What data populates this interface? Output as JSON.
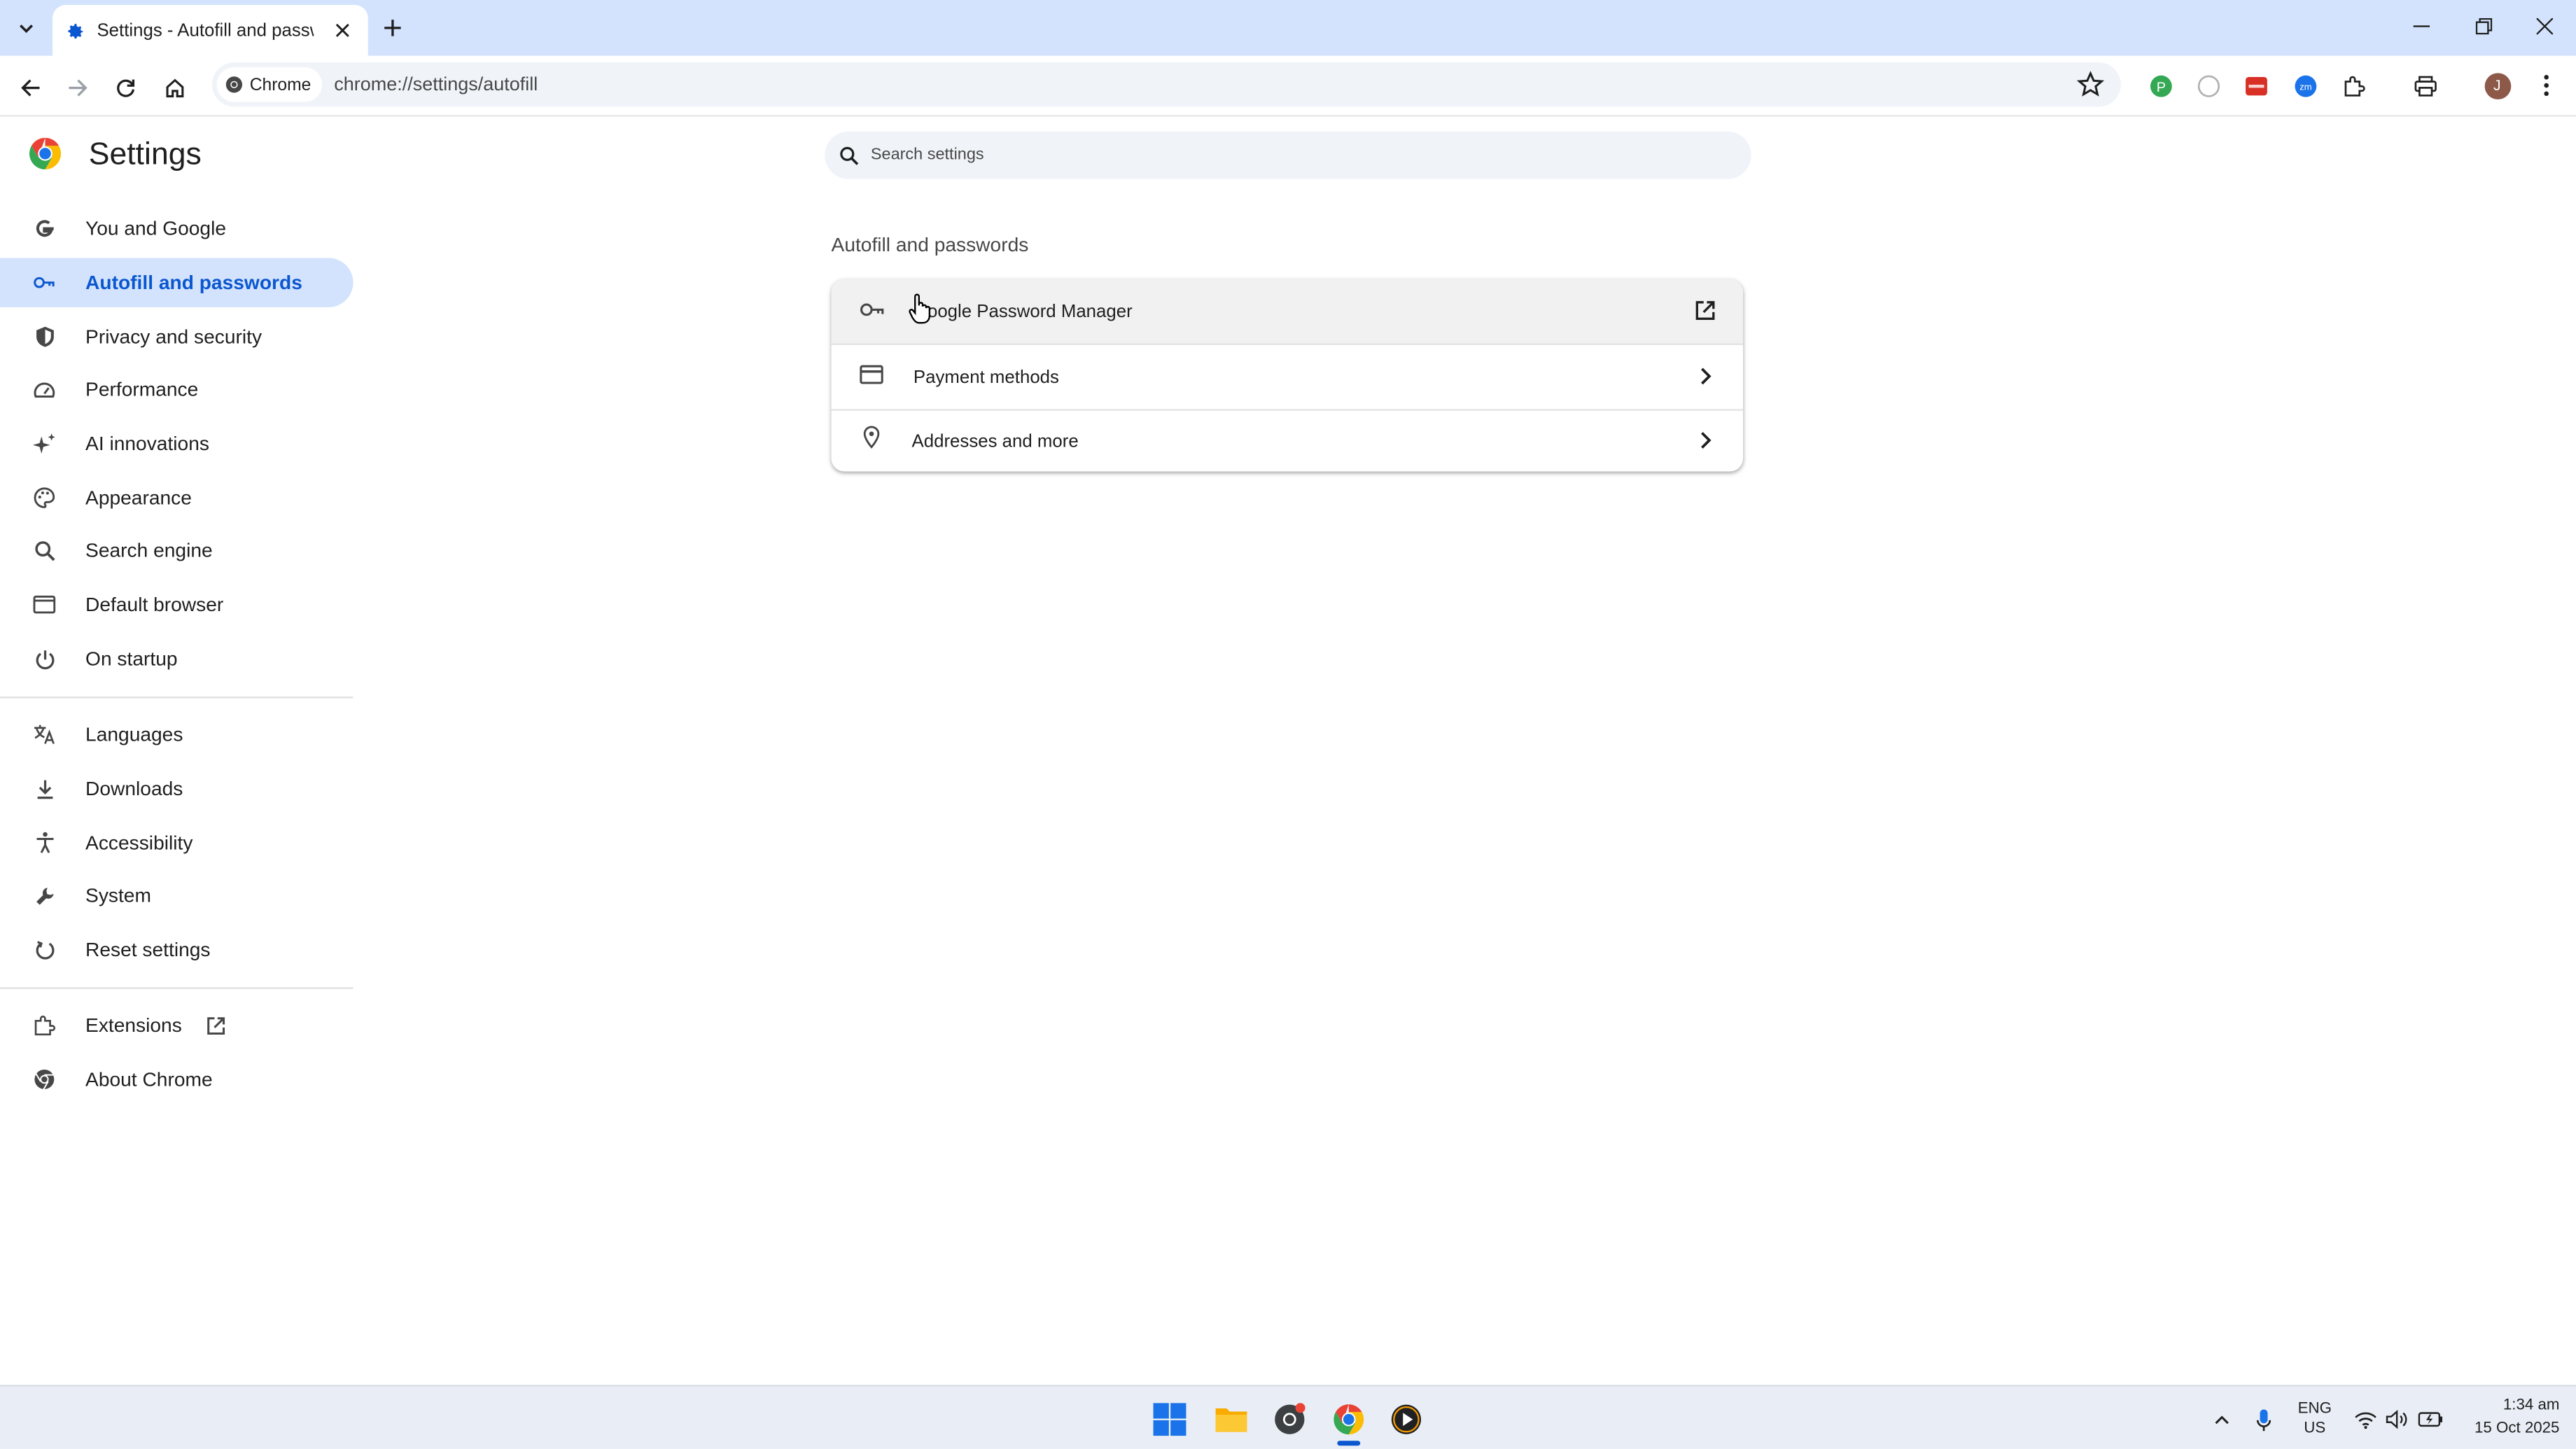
{
  "tab": {
    "title": "Settings - Autofill and passwords"
  },
  "omnibox": {
    "chip_label": "Chrome",
    "url": "chrome://settings/autofill"
  },
  "profile": {
    "initial": "J"
  },
  "settings": {
    "title": "Settings",
    "search_placeholder": "Search settings",
    "nav": [
      {
        "label": "You and Google",
        "icon": "google-icon"
      },
      {
        "label": "Autofill and passwords",
        "icon": "key-icon",
        "active": true
      },
      {
        "label": "Privacy and security",
        "icon": "shield-icon"
      },
      {
        "label": "Performance",
        "icon": "speedometer-icon"
      },
      {
        "label": "AI innovations",
        "icon": "sparkle-icon"
      },
      {
        "label": "Appearance",
        "icon": "palette-icon"
      },
      {
        "label": "Search engine",
        "icon": "search-icon"
      },
      {
        "label": "Default browser",
        "icon": "browser-window-icon"
      },
      {
        "label": "On startup",
        "icon": "power-icon"
      },
      {
        "label": "Languages",
        "icon": "translate-icon"
      },
      {
        "label": "Downloads",
        "icon": "download-icon"
      },
      {
        "label": "Accessibility",
        "icon": "accessibility-icon"
      },
      {
        "label": "System",
        "icon": "wrench-icon"
      },
      {
        "label": "Reset settings",
        "icon": "reset-icon"
      },
      {
        "label": "Extensions",
        "icon": "puzzle-icon"
      },
      {
        "label": "About Chrome",
        "icon": "chrome-icon"
      }
    ],
    "section_title": "Autofill and passwords",
    "rows": [
      {
        "label": "Google Password Manager",
        "icon": "key-icon",
        "trailing": "external-link-icon"
      },
      {
        "label": "Payment methods",
        "icon": "credit-card-icon",
        "trailing": "chevron-right-icon"
      },
      {
        "label": "Addresses and more",
        "icon": "location-pin-icon",
        "trailing": "chevron-right-icon"
      }
    ]
  },
  "taskbar": {
    "lang_top": "ENG",
    "lang_bottom": "US",
    "time": "1:34 am",
    "date": "15 Oct 2025"
  },
  "colors": {
    "accent": "#0b57d0",
    "active_bg": "#d3e3fd",
    "tabstrip": "#d3e3fd"
  }
}
